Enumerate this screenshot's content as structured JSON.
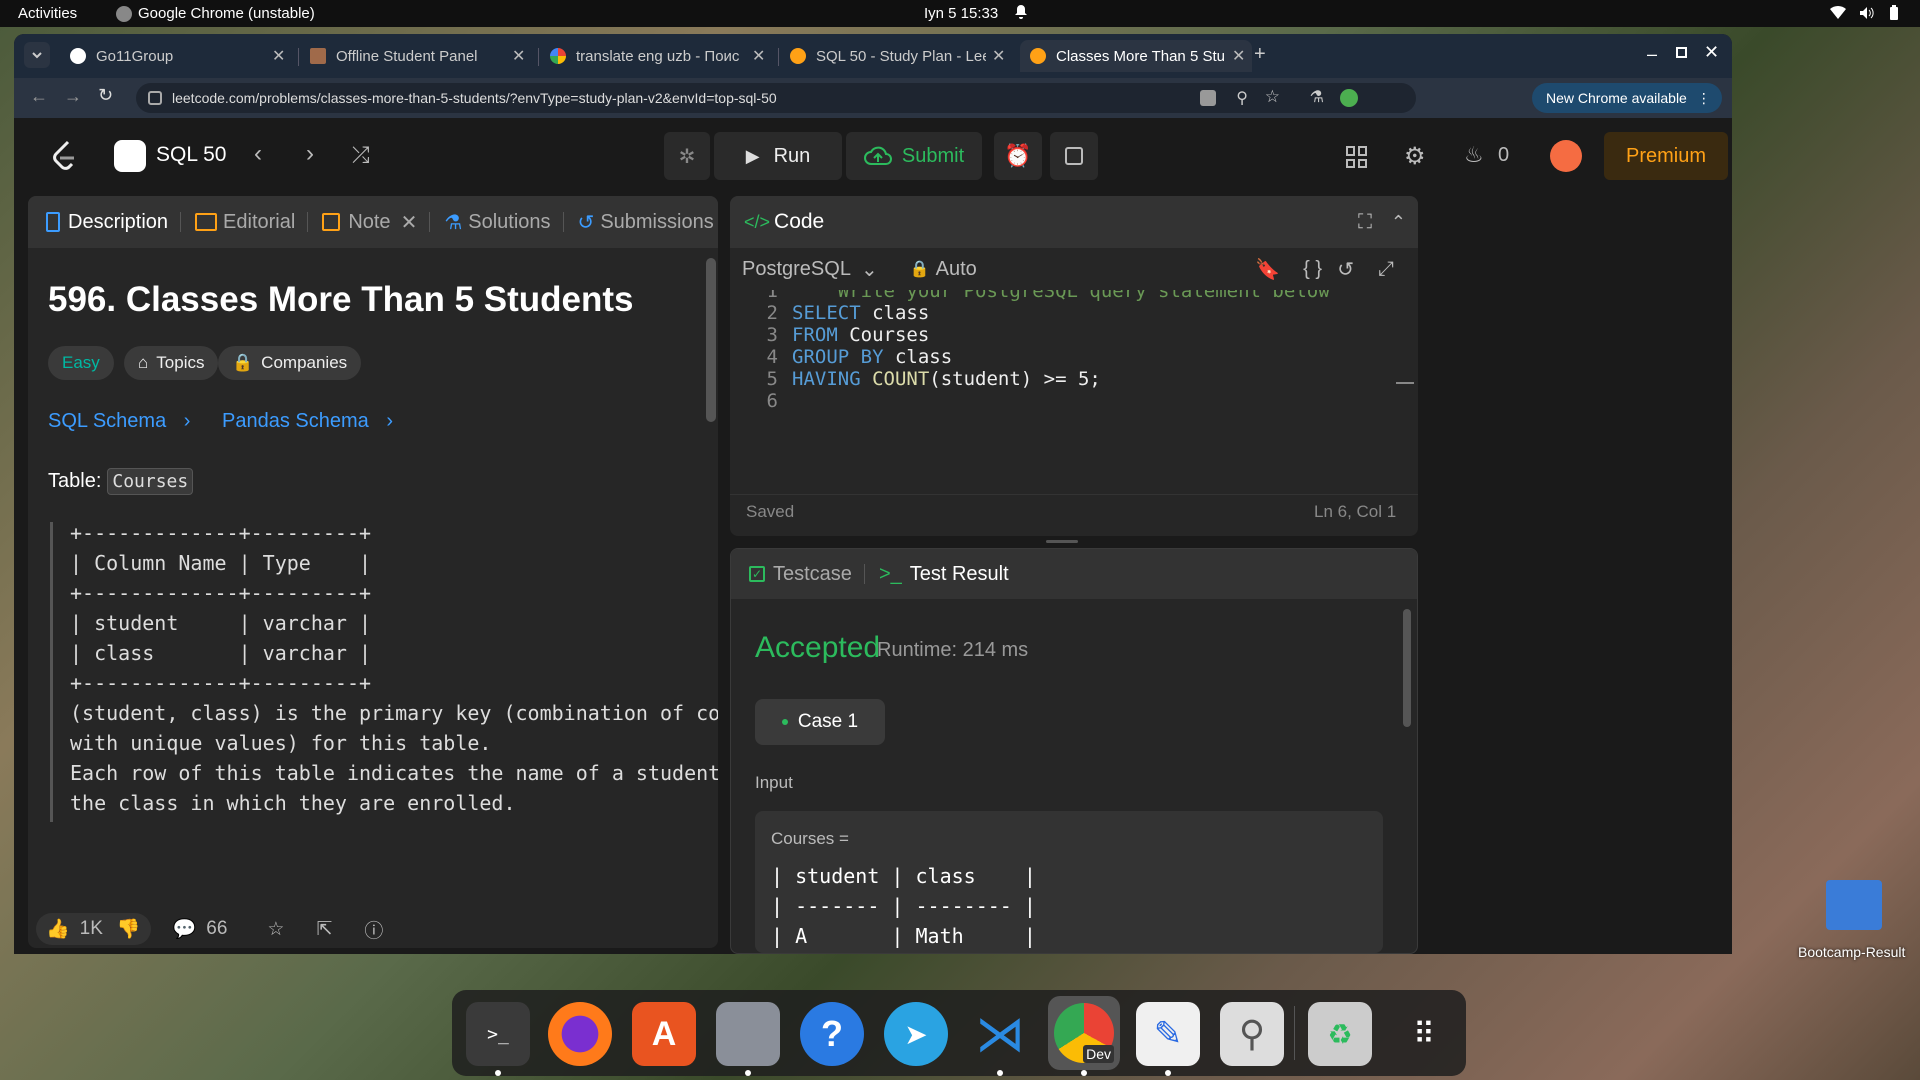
{
  "system": {
    "activities": "Activities",
    "app_name": "Google Chrome (unstable)",
    "datetime": "Iyn 5  15:33"
  },
  "browser": {
    "tabs": [
      {
        "label": "Go11Group"
      },
      {
        "label": "Offline Student Panel"
      },
      {
        "label": "translate eng uzb - Поис"
      },
      {
        "label": "SQL 50 - Study Plan - Lee"
      },
      {
        "label": "Classes More Than 5 Stu"
      }
    ],
    "url": "leetcode.com/problems/classes-more-than-5-students/?envType=study-plan-v2&envId=top-sql-50",
    "update_label": "New Chrome available"
  },
  "nav": {
    "study_plan": "SQL 50",
    "run": "Run",
    "submit": "Submit",
    "streak": "0",
    "premium": "Premium"
  },
  "left_panel": {
    "tabs": {
      "description": "Description",
      "editorial": "Editorial",
      "note": "Note",
      "solutions": "Solutions",
      "submissions": "Submissions"
    },
    "title": "596. Classes More Than 5 Students",
    "difficulty": "Easy",
    "topics": "Topics",
    "companies": "Companies",
    "sql_schema": "SQL Schema",
    "pandas_schema": "Pandas Schema",
    "table_label": "Table:",
    "table_name": "Courses",
    "schema_lines": [
      "+-------------+---------+",
      "| Column Name | Type    |",
      "+-------------+---------+",
      "| student     | varchar |",
      "| class       | varchar |",
      "+-------------+---------+"
    ],
    "description_lines": [
      "(student, class) is the primary key (combination of columns",
      "with unique values) for this table.",
      "Each row of this table indicates the name of a student and",
      "the class in which they are enrolled."
    ],
    "likes": "1K",
    "comments": "66"
  },
  "code_panel": {
    "title": "Code",
    "language": "PostgreSQL",
    "mode": "Auto",
    "lines": [
      {
        "n": "1",
        "parts": [
          {
            "t": "    Write your PostgreSQL query statement below",
            "c": "cm"
          }
        ]
      },
      {
        "n": "2",
        "parts": [
          {
            "t": "SELECT",
            "c": "kw"
          },
          {
            "t": " class",
            "c": ""
          }
        ]
      },
      {
        "n": "3",
        "parts": [
          {
            "t": "FROM",
            "c": "kw"
          },
          {
            "t": " Courses",
            "c": ""
          }
        ]
      },
      {
        "n": "4",
        "parts": [
          {
            "t": "GROUP BY",
            "c": "kw"
          },
          {
            "t": " class",
            "c": ""
          }
        ]
      },
      {
        "n": "5",
        "parts": [
          {
            "t": "HAVING",
            "c": "kw"
          },
          {
            "t": " COUNT",
            "c": "fn"
          },
          {
            "t": "(student) >= 5;",
            "c": ""
          }
        ]
      },
      {
        "n": "6",
        "parts": []
      }
    ],
    "saved": "Saved",
    "cursor": "Ln 6, Col 1"
  },
  "result_panel": {
    "tabs": {
      "testcase": "Testcase",
      "result": "Test Result"
    },
    "status": "Accepted",
    "runtime": "Runtime: 214 ms",
    "case": "Case 1",
    "input_label": "Input",
    "input_table_name": "Courses =",
    "input_lines": [
      "| student | class    |",
      "| ------- | -------- |",
      "| A       | Math     |"
    ]
  },
  "desktop": {
    "folder_label": "Bootcamp-Result"
  },
  "dock": {
    "chrome_badge": "Dev"
  },
  "colors": {
    "accent_green": "#2cbb5d",
    "link_blue": "#3c9cff",
    "premium_orange": "#ffa116",
    "easy_teal": "#00b8a3"
  }
}
